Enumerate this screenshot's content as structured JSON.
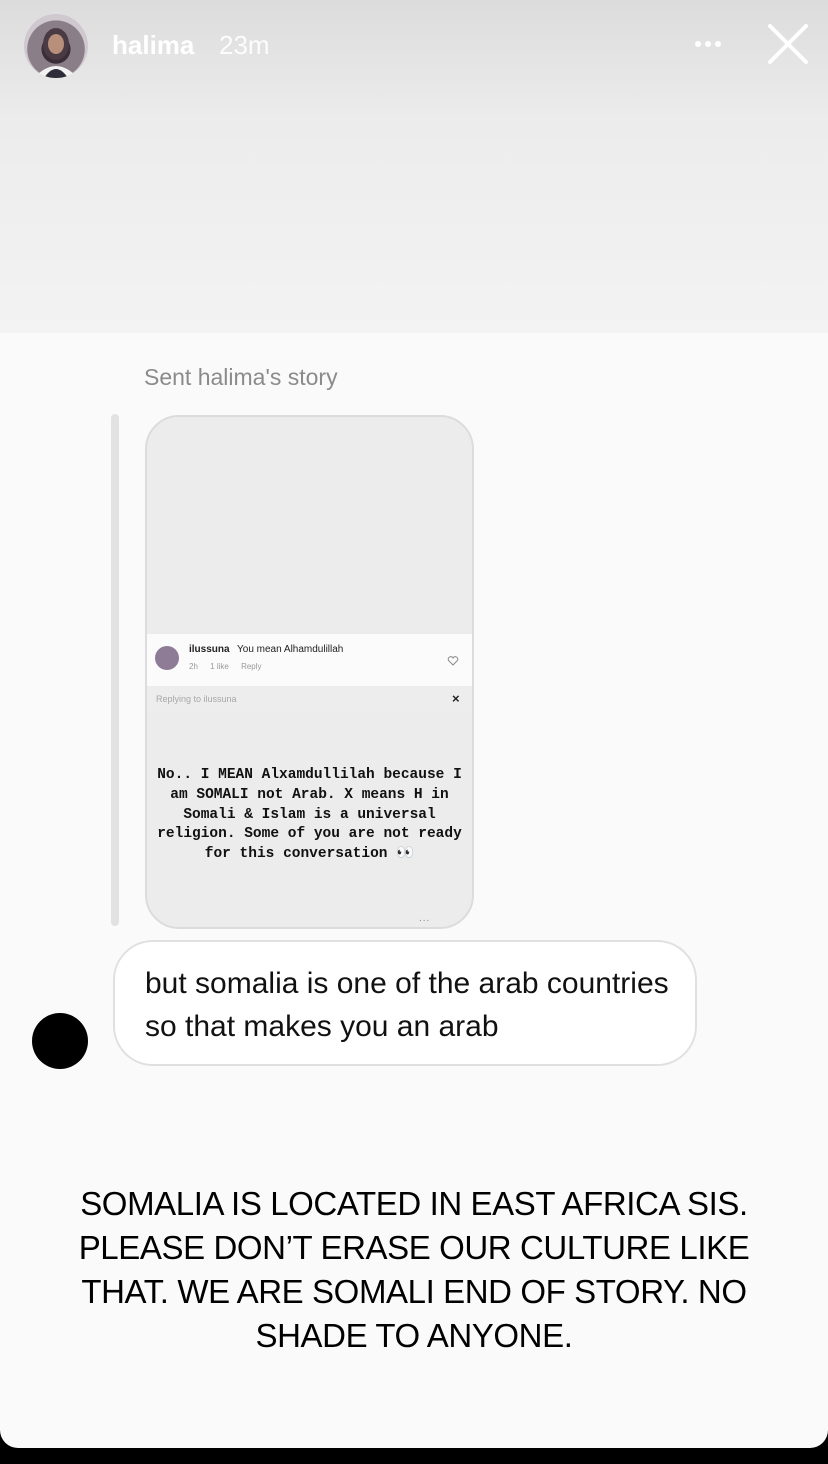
{
  "header": {
    "username": "halima",
    "time": "23m",
    "more_icon": "more-horizontal-icon",
    "close_icon": "close-icon"
  },
  "shared_story": {
    "label": "Sent halima's story",
    "comment": {
      "username": "ilussuna",
      "text": "You mean Alhamdulillah",
      "age": "2h",
      "likes": "1 like",
      "reply": "Reply"
    },
    "replying_to": "Replying to ilussuna",
    "close_glyph": "×",
    "typed_text": "No.. I MEAN Alxamdullilah because I am SOMALI not Arab. X means H in Somali & Islam is a universal religion. Some of you are not ready for this conversation 👀",
    "ellipsis": "..."
  },
  "message": {
    "text": "but somalia is one of the arab countries so that makes you an arab"
  },
  "caption": "SOMALIA IS LOCATED IN EAST AFRICA SIS. PLEASE DON’T ERASE OUR CULTURE LIKE THAT. WE ARE SOMALI END OF STORY. NO SHADE TO ANYONE."
}
